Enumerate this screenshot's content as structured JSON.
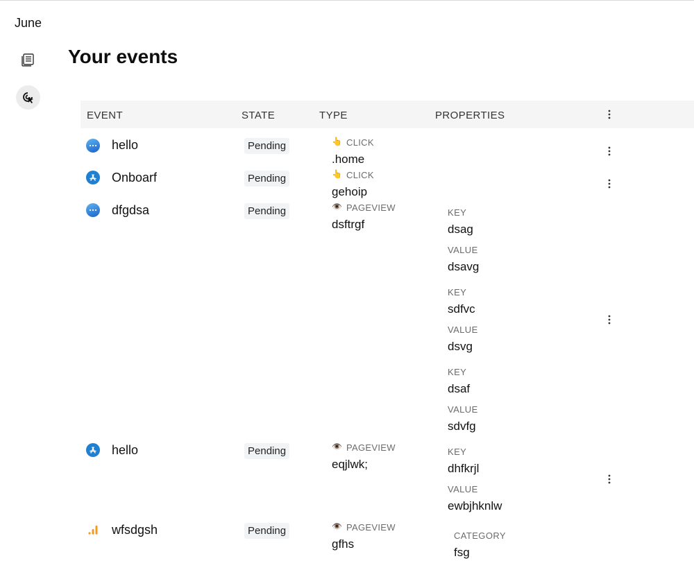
{
  "app": {
    "name": "June"
  },
  "page": {
    "title": "Your events"
  },
  "nav": [
    {
      "icon": "document-list-icon"
    },
    {
      "icon": "cursor-click-icon",
      "active": true
    }
  ],
  "table": {
    "headers": {
      "event": "EVENT",
      "state": "STATE",
      "type": "TYPE",
      "properties": "PROPERTIES"
    },
    "rows": [
      {
        "name": "hello",
        "icon": "chat-bubble-icon",
        "state": "Pending",
        "type": {
          "emoji": "👆",
          "label": "CLICK",
          "value": ".home"
        },
        "properties": []
      },
      {
        "name": "Onboarf",
        "icon": "app-store-icon",
        "state": "Pending",
        "type": {
          "emoji": "👆",
          "label": "CLICK",
          "value": "gehoip"
        },
        "properties": []
      },
      {
        "name": "dfgdsa",
        "icon": "chat-bubble-icon",
        "state": "Pending",
        "type": {
          "emoji": "👁️",
          "label": "PAGEVIEW",
          "value": "dsftrgf"
        },
        "properties": [
          {
            "key_label": "KEY",
            "key": "dsag",
            "value_label": "VALUE",
            "value": "dsavg"
          },
          {
            "key_label": "KEY",
            "key": "sdfvc",
            "value_label": "VALUE",
            "value": "dsvg"
          },
          {
            "key_label": "KEY",
            "key": "dsaf",
            "value_label": "VALUE",
            "value": "sdvfg"
          }
        ]
      },
      {
        "name": "hello",
        "icon": "app-store-icon",
        "state": "Pending",
        "type": {
          "emoji": "👁️",
          "label": "PAGEVIEW",
          "value": "eqjlwk;"
        },
        "properties": [
          {
            "key_label": "KEY",
            "key": "dhfkrjl",
            "value_label": "VALUE",
            "value": "ewbjhknlw"
          }
        ]
      },
      {
        "name": "wfsdgsh",
        "icon": "bar-chart-icon",
        "state": "Pending",
        "type": {
          "emoji": "👁️",
          "label": "PAGEVIEW",
          "value": "gfhs"
        },
        "properties": [
          {
            "category_label": "CATEGORY",
            "category": "fsg"
          }
        ]
      }
    ]
  },
  "colors": {
    "accent_blue": "#1f7fd1",
    "chart_orange": "#f29b1f",
    "badge_bg": "#f1f3f5",
    "header_bg": "#f5f5f5"
  }
}
